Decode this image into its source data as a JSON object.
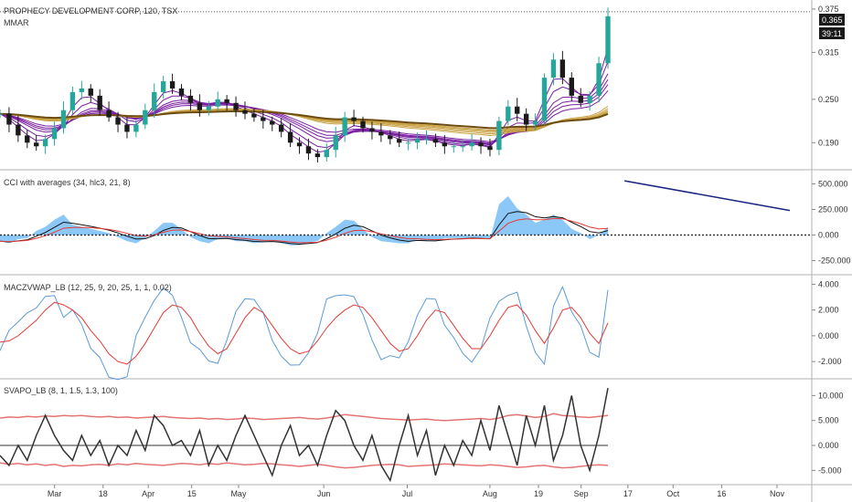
{
  "chart_data": [
    {
      "type": "candlestick",
      "title": "PROPHECY DEVELOPMENT CORP, 120, TSX",
      "overlay": "MMAR",
      "y_ticks": [
        0.375,
        0.315,
        0.25,
        0.19
      ],
      "y_tick_labels": [
        "0.375",
        "0.315",
        "0.250",
        "0.190"
      ],
      "ylim": [
        0.155,
        0.385
      ],
      "last_price_label": "0.365",
      "countdown_label": "39:11",
      "close_series": [
        0.23,
        0.215,
        0.2,
        0.19,
        0.185,
        0.195,
        0.21,
        0.235,
        0.26,
        0.265,
        0.255,
        0.235,
        0.225,
        0.215,
        0.205,
        0.215,
        0.235,
        0.26,
        0.275,
        0.265,
        0.255,
        0.245,
        0.235,
        0.24,
        0.25,
        0.245,
        0.235,
        0.23,
        0.225,
        0.22,
        0.215,
        0.205,
        0.19,
        0.185,
        0.175,
        0.17,
        0.18,
        0.2,
        0.225,
        0.22,
        0.21,
        0.205,
        0.2,
        0.195,
        0.19,
        0.19,
        0.195,
        0.195,
        0.19,
        0.185,
        0.185,
        0.185,
        0.19,
        0.185,
        0.18,
        0.22,
        0.24,
        0.23,
        0.215,
        0.22,
        0.28,
        0.305,
        0.28,
        0.255,
        0.245,
        0.255,
        0.3,
        0.365
      ],
      "colors": {
        "up": "#26a69a",
        "down": "#1a1a1a",
        "mma_fast": "#7b1fa2",
        "mma_slow": "#c8a040",
        "mma_slowest": "#6d4c11"
      }
    },
    {
      "type": "line",
      "title": "CCI with averages (34, hlc3, 21, 8)",
      "y_ticks": [
        500,
        250,
        0,
        -250
      ],
      "y_tick_labels": [
        "500.000",
        "250.000",
        "0.000",
        "-250.000"
      ],
      "ylim": [
        -370,
        620
      ],
      "cci_series": [
        -60,
        -80,
        -40,
        -30,
        40,
        80,
        150,
        200,
        100,
        80,
        60,
        40,
        20,
        -20,
        -60,
        -80,
        -30,
        40,
        120,
        120,
        60,
        -20,
        -60,
        -80,
        -40,
        -30,
        -60,
        -60,
        -80,
        -70,
        -60,
        -80,
        -100,
        -100,
        -70,
        -60,
        20,
        80,
        150,
        140,
        60,
        -20,
        -60,
        -70,
        -80,
        -80,
        -40,
        -60,
        -60,
        -30,
        -30,
        -30,
        -20,
        -40,
        -40,
        300,
        380,
        260,
        200,
        120,
        150,
        200,
        150,
        60,
        20,
        -40,
        0,
        80
      ],
      "trendline": [
        [
          0.733,
          530
        ],
        [
          0.927,
          240
        ]
      ],
      "colors": {
        "fill": "#64b5f6",
        "avg1": "#111111",
        "avg2": "#e53935",
        "trendline": "#1a237e",
        "zero": "#333333"
      }
    },
    {
      "type": "line",
      "title": "MACZVWAP_LB (12, 25, 9, 20, 25, 1, 1, 0.02)",
      "y_ticks": [
        4,
        2,
        0,
        -2
      ],
      "y_tick_labels": [
        "4.000",
        "2.000",
        "0.000",
        "-2.000"
      ],
      "ylim": [
        -3.2,
        4.6
      ],
      "signal_series": [
        -0.5,
        -0.4,
        0,
        0.6,
        1.2,
        2,
        2.6,
        2.4,
        2,
        1.4,
        0.4,
        -0.4,
        -1.4,
        -2,
        -2.2,
        -1.6,
        -0.6,
        0.6,
        1.8,
        2.4,
        2.2,
        1.4,
        0.2,
        -0.8,
        -1.4,
        -1,
        0.2,
        1.4,
        2.2,
        1.8,
        0.8,
        -0.2,
        -1,
        -1.4,
        -1.2,
        -0.4,
        0.6,
        1.4,
        2,
        2.4,
        2.2,
        1.4,
        0.4,
        -0.6,
        -1.2,
        -1,
        0,
        1.2,
        2,
        1.8,
        0.8,
        -0.2,
        -1,
        -1,
        0,
        1.2,
        2.2,
        2.4,
        1.6,
        0.4,
        -0.6,
        0.6,
        2,
        2.2,
        1.4,
        0.2,
        -0.6,
        1
      ],
      "colors": {
        "macd": "#5c9bd6",
        "signal": "#e53935"
      }
    },
    {
      "type": "line",
      "title": "SVAPO_LB (8, 1, 1.5, 1.3, 100)",
      "y_ticks": [
        10,
        5,
        0,
        -5
      ],
      "y_tick_labels": [
        "10.000",
        "5.000",
        "0.000",
        "-5.000"
      ],
      "ylim": [
        -7.5,
        13
      ],
      "svapo_series": [
        -2,
        -4,
        0,
        -3,
        2,
        6,
        2,
        -1,
        -3,
        2,
        -2,
        1,
        -4,
        0,
        -2,
        3,
        -1,
        6,
        4,
        0,
        1,
        -2,
        3,
        -4,
        0,
        -3,
        2,
        6,
        2,
        -2,
        -6,
        0,
        4,
        -2,
        0,
        -4,
        2,
        7,
        5,
        0,
        -3,
        2,
        -4,
        -7,
        0,
        6,
        -2,
        3,
        -6,
        0,
        -4,
        1,
        -2,
        5,
        -1,
        8,
        2,
        -4,
        6,
        0,
        8,
        -3,
        2,
        10,
        0,
        -5,
        2,
        11.5
      ],
      "upper_band": [
        5.5,
        5.7,
        5.6,
        5.8,
        5.7,
        5.9,
        5.8,
        6,
        5.9,
        6,
        5.8,
        5.7,
        5.8,
        5.6,
        5.7,
        5.5,
        5.6,
        5.7,
        5.8,
        5.6,
        5.5,
        5.4,
        5.5,
        5.3,
        5.4,
        5.2,
        5.3,
        5.5,
        5.4,
        5.2,
        5.3,
        5.4,
        5.5,
        5.6,
        5.4,
        5.3,
        5.5,
        5.8,
        6.2,
        6,
        5.8,
        5.6,
        5.4,
        5.3,
        5.2,
        5.1,
        5.2,
        5.3,
        5.1,
        5,
        5.1,
        5.2,
        5.3,
        5.4,
        5.2,
        5.5,
        6,
        6.2,
        5.9,
        5.6,
        5.8,
        6.4,
        6,
        5.9,
        5.7,
        5.6,
        5.8,
        6
      ],
      "lower_band": [
        -3.5,
        -3.8,
        -3.6,
        -3.9,
        -3.7,
        -4,
        -3.8,
        -4.2,
        -4,
        -4.1,
        -3.9,
        -3.8,
        -4,
        -3.7,
        -3.9,
        -3.6,
        -3.8,
        -3.9,
        -4,
        -3.8,
        -3.6,
        -3.7,
        -3.9,
        -3.6,
        -3.8,
        -3.5,
        -3.7,
        -3.9,
        -3.8,
        -3.6,
        -3.7,
        -3.9,
        -4,
        -4.2,
        -4,
        -3.8,
        -4,
        -4.3,
        -4.5,
        -4.4,
        -4.2,
        -4,
        -3.9,
        -3.8,
        -3.9,
        -4.2,
        -4.1,
        -4,
        -3.9,
        -3.7,
        -3.8,
        -3.9,
        -4,
        -4.1,
        -3.9,
        -4,
        -4.2,
        -4.4,
        -4.3,
        -4.1,
        -4,
        -4.3,
        -4.5,
        -4.4,
        -4.2,
        -4,
        -3.9,
        -4
      ],
      "colors": {
        "line": "#333333",
        "bands": "#e57373",
        "zero": "#333333"
      }
    }
  ],
  "x_axis_labels": [
    {
      "label": "Mar",
      "pos": 0.064
    },
    {
      "label": "18",
      "pos": 0.121
    },
    {
      "label": "Apr",
      "pos": 0.174
    },
    {
      "label": "15",
      "pos": 0.225
    },
    {
      "label": "May",
      "pos": 0.28
    },
    {
      "label": "Jun",
      "pos": 0.38
    },
    {
      "label": "Jul",
      "pos": 0.478
    },
    {
      "label": "Aug",
      "pos": 0.575
    },
    {
      "label": "19",
      "pos": 0.632
    },
    {
      "label": "Sep",
      "pos": 0.682
    },
    {
      "label": "17",
      "pos": 0.737
    },
    {
      "label": "Oct",
      "pos": 0.79
    },
    {
      "label": "16",
      "pos": 0.847
    },
    {
      "label": "Nov",
      "pos": 0.912
    }
  ]
}
